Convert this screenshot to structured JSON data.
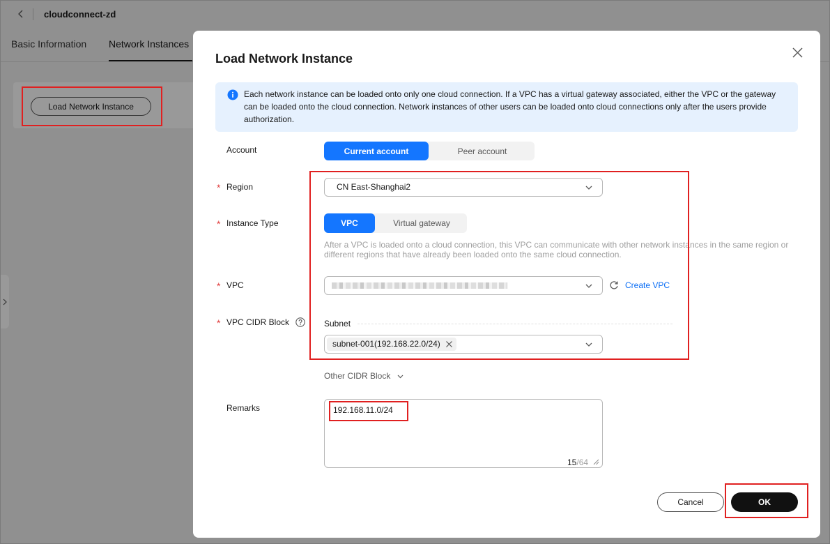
{
  "header": {
    "title": "cloudconnect-zd",
    "back_icon": "chevron-left-icon"
  },
  "tabs": [
    {
      "label": "Basic Information",
      "active": false
    },
    {
      "label": "Network Instances",
      "active": true
    }
  ],
  "page": {
    "load_button_label": "Load Network Instance"
  },
  "modal": {
    "title": "Load Network Instance",
    "close_icon": "close-icon",
    "info": {
      "icon": "info-icon",
      "text": "Each network instance can be loaded onto only one cloud connection. If a VPC has a virtual gateway associated, either the VPC or the gateway can be loaded onto the cloud connection. Network instances of other users can be loaded onto cloud connections only after the users provide authorization."
    }
  },
  "form": {
    "required_mark": "*",
    "account": {
      "label": "Account",
      "options": [
        "Current account",
        "Peer account"
      ],
      "selected": "Current account"
    },
    "region": {
      "label": "Region",
      "value": "CN East-Shanghai2"
    },
    "instance_type": {
      "label": "Instance Type",
      "options": [
        "VPC",
        "Virtual gateway"
      ],
      "selected": "VPC",
      "help": "After a VPC is loaded onto a cloud connection, this VPC can communicate with other network instances in the same region or different regions that have already been loaded onto the same cloud connection."
    },
    "vpc": {
      "label": "VPC",
      "create_link": "Create VPC",
      "refresh_icon": "refresh-icon"
    },
    "cidr": {
      "label": "VPC CIDR Block",
      "help_icon": "question-circle-icon",
      "subnet_label": "Subnet",
      "subnet_tag": "subnet-001(192.168.22.0/24)",
      "other_label": "Other CIDR Block"
    },
    "remarks": {
      "label": "Remarks",
      "value": "192.168.11.0/24",
      "count": "15",
      "limit": "/64"
    }
  },
  "footer": {
    "cancel": "Cancel",
    "ok": "OK"
  },
  "colors": {
    "primary": "#1476ff",
    "link": "#0b6ef5",
    "ok_button": "#111111",
    "info_bg": "#e6f1fe",
    "required": "#e03c3c",
    "annotation": "#e02020"
  }
}
